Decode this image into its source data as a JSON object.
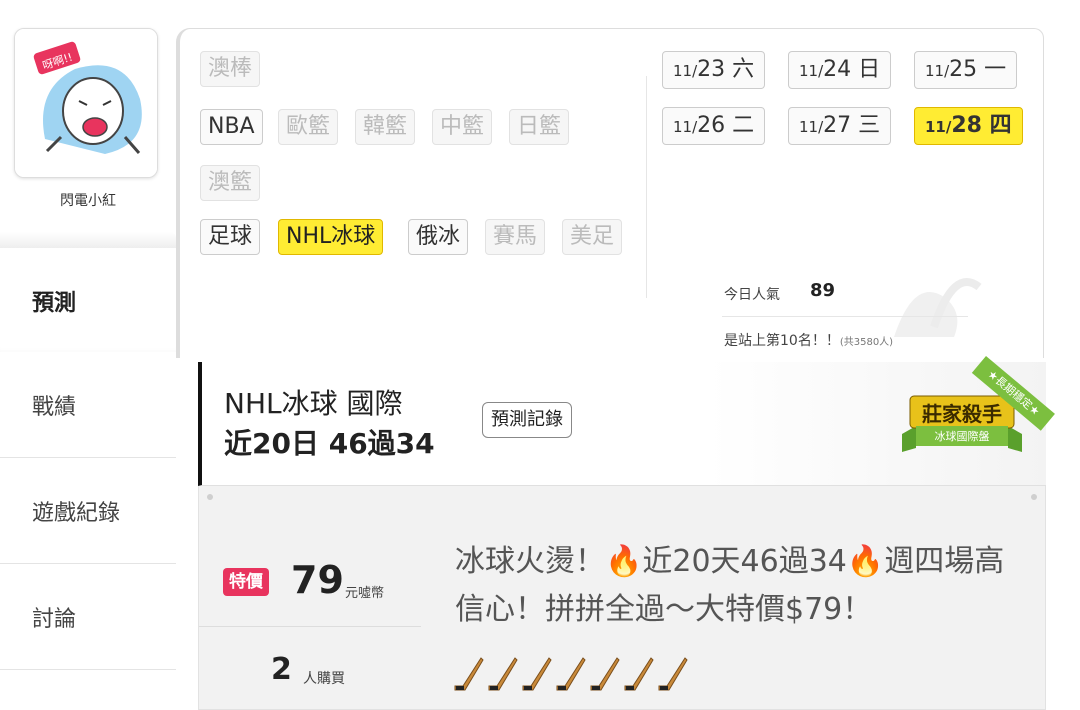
{
  "user": {
    "name": "閃電小紅"
  },
  "nav": {
    "items": [
      {
        "label": "預測"
      },
      {
        "label": "戰績"
      },
      {
        "label": "遊戲紀錄"
      },
      {
        "label": "討論"
      }
    ]
  },
  "sports": {
    "row1": [
      "澳棒"
    ],
    "row2": [
      "NBA",
      "歐籃",
      "韓籃",
      "中籃",
      "日籃"
    ],
    "row3": [
      "澳籃"
    ],
    "row4": [
      "足球",
      "NHL冰球",
      "俄冰",
      "賽馬",
      "美足"
    ],
    "selected": "NHL冰球"
  },
  "dates": [
    {
      "md": "11/",
      "day": "23",
      "wd": "六"
    },
    {
      "md": "11/",
      "day": "24",
      "wd": "日"
    },
    {
      "md": "11/",
      "day": "25",
      "wd": "一"
    },
    {
      "md": "11/",
      "day": "26",
      "wd": "二"
    },
    {
      "md": "11/",
      "day": "27",
      "wd": "三"
    },
    {
      "md": "11/",
      "day": "28",
      "wd": "四"
    }
  ],
  "stats": {
    "popularity_label": "今日人氣",
    "popularity_value": "89",
    "rank_text": "是站上第10名！！",
    "rank_total": "(共3580人)"
  },
  "category": {
    "title": "NHL冰球 國際",
    "record": "近20日 46過34",
    "record_button": "預測記錄",
    "badge_title": "莊家殺手",
    "badge_sub": "冰球國際盤",
    "ribbon": "★長期穩定★"
  },
  "deal": {
    "tag": "特價",
    "price": "79",
    "price_unit": "元噓幣",
    "buyers": "2",
    "buyers_unit": "人購買",
    "text_part1": "冰球火燙！",
    "text_part2": "近20天46過34",
    "text_part3": "週四場高信心！拼拼全過～大特價$79！",
    "stick_count": 7
  },
  "colors": {
    "selected_yellow": "#ffec33",
    "sale_pink": "#e8345e",
    "flame": "#ff6a00"
  }
}
